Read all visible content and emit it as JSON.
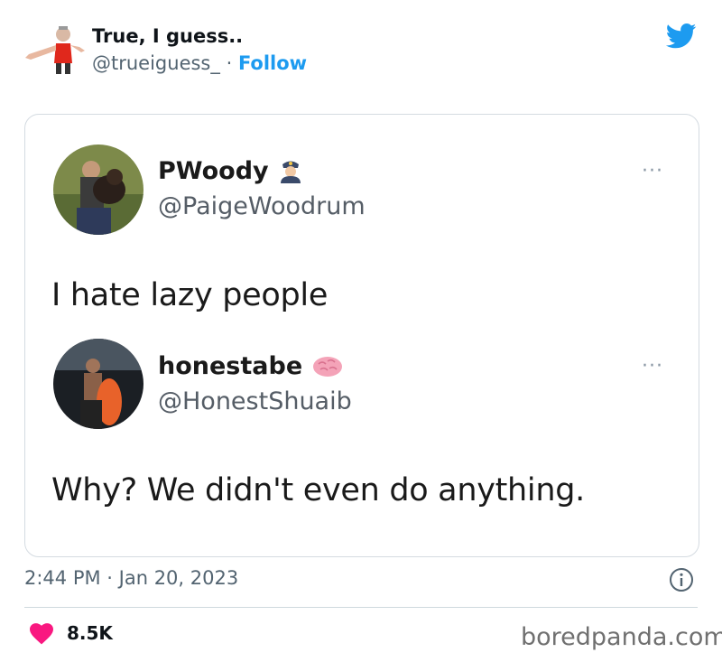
{
  "tweet": {
    "author_name": "True, I guess..",
    "author_handle": "@trueiguess_",
    "separator": "·",
    "follow_label": "Follow",
    "timestamp": "2:44 PM · Jan 20, 2023",
    "likes": "8.5K"
  },
  "screenshot": {
    "first_post": {
      "name": "PWoody",
      "handle": "@PaigeWoodrum",
      "text": "I hate lazy people",
      "more": "···"
    },
    "second_post": {
      "name": "honestabe",
      "handle": "@HonestShuaib",
      "text": "Why? We didn't even do anything.",
      "more": "···"
    }
  },
  "watermark": "boredpanda.com",
  "colors": {
    "accent": "#1d9bf0",
    "like": "#f91880",
    "secondary_text": "#536471"
  },
  "icons": [
    "twitter-bird-icon",
    "info-icon",
    "heart-icon",
    "more-options-icon",
    "police-emoji-icon",
    "brain-emoji-icon"
  ]
}
